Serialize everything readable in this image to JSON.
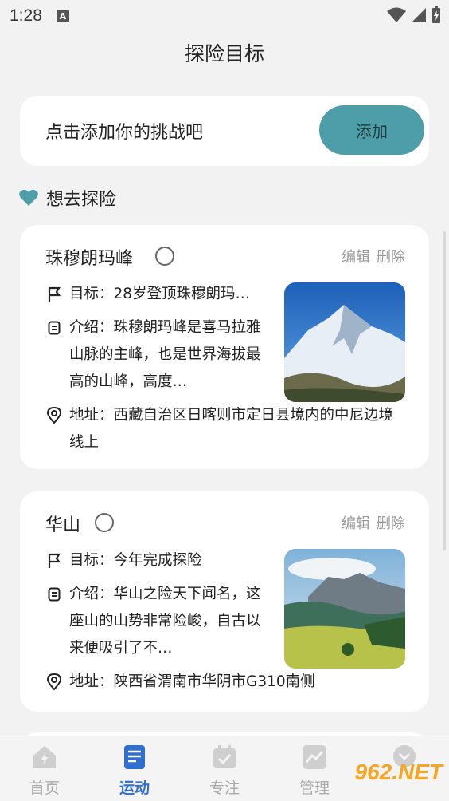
{
  "status": {
    "time": "1:28",
    "notif": "A"
  },
  "page_title": "探险目标",
  "add": {
    "prompt": "点击添加你的挑战吧",
    "button_label": "添加"
  },
  "section": {
    "label": "想去探险"
  },
  "items": [
    {
      "name": "珠穆朗玛峰",
      "edit": "编辑",
      "delete": "删除",
      "goal": "目标：28岁登顶珠穆朗玛…",
      "intro": "介绍：珠穆朗玛峰是喜马拉雅山脉的主峰，也是世界海拔最高的山峰，高度…",
      "address": "地址：西藏自治区日喀则市定日县境内的中尼边境线上"
    },
    {
      "name": "华山",
      "edit": "编辑",
      "delete": "删除",
      "goal": "目标：今年完成探险",
      "intro": "介绍：华山之险天下闻名，这座山的山势非常险峻，自古以来便吸引了不…",
      "address": "地址：陕西省渭南市华阴市G310南侧"
    }
  ],
  "nav": [
    {
      "label": "首页"
    },
    {
      "label": "运动"
    },
    {
      "label": "专注"
    },
    {
      "label": "管理"
    }
  ],
  "colors": {
    "accent": "#4d9ea9",
    "active_nav": "#2f6fd0"
  },
  "watermark": "962.NET"
}
